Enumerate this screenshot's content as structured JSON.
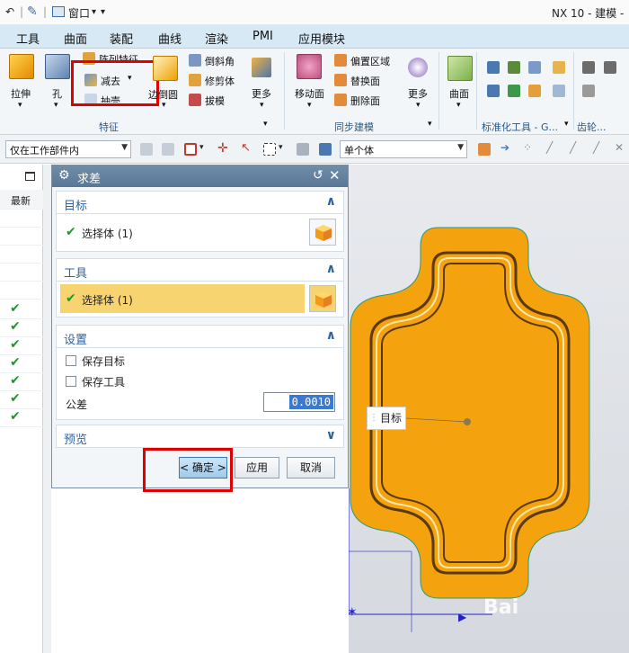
{
  "titlebar": {
    "window_menu": "窗口",
    "right_title": "NX 10 - 建模 -"
  },
  "menu": [
    "工具",
    "曲面",
    "装配",
    "曲线",
    "渲染",
    "PMI",
    "应用模块"
  ],
  "ribbon": {
    "extrude": "拉伸",
    "hole": "孔",
    "pattern": "阵列特征",
    "subtract": "减去",
    "emboss": "抽壳",
    "edge_blend": "边倒圆",
    "chamfer": "倒斜角",
    "trim_body": "修剪体",
    "draft": "拔模",
    "more1": "更多",
    "group_feature": "特征",
    "move_face": "移动面",
    "offset_region": "偏置区域",
    "replace_face": "替换面",
    "delete_face": "删除面",
    "more2": "更多",
    "group_sync": "同步建模",
    "surface": "曲面",
    "group_std_tools": "标准化工具 - G...",
    "group_gear": "齿轮..."
  },
  "selbar": {
    "filter": "仅在工作部件内",
    "body_type": "单个体"
  },
  "nav": {
    "header": "最新",
    "checks": 7
  },
  "dialog": {
    "title": "求差",
    "target_hdr": "目标",
    "target_sel": "选择体 (1)",
    "tool_hdr": "工具",
    "tool_sel": "选择体 (1)",
    "settings_hdr": "设置",
    "keep_target": "保存目标",
    "keep_tool": "保存工具",
    "tolerance_label": "公差",
    "tolerance_value": "0.0010",
    "preview_hdr": "预览",
    "ok": "< 确定 >",
    "apply": "应用",
    "cancel": "取消"
  },
  "graphics": {
    "target_label": "目标",
    "watermark": "Bai"
  },
  "colors": {
    "part": "#f4a30e",
    "accent": "#2b63a8",
    "highlight": "#f8d470",
    "red": "#e00000"
  }
}
